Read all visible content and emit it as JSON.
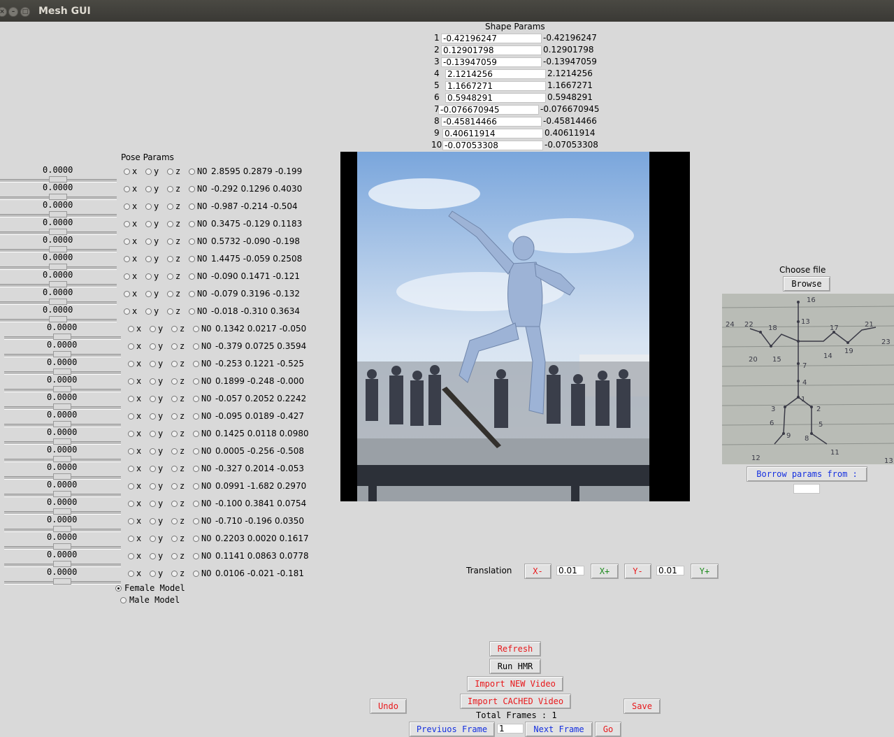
{
  "window": {
    "title": "Mesh GUI"
  },
  "shape": {
    "title": "Shape Params",
    "rows": [
      {
        "idx": "1",
        "value": "-0.42196247",
        "echo": "-0.42196247"
      },
      {
        "idx": "2",
        "value": "0.12901798",
        "echo": "0.12901798"
      },
      {
        "idx": "3",
        "value": "-0.13947059",
        "echo": "-0.13947059"
      },
      {
        "idx": "4",
        "value": "2.1214256",
        "echo": "2.1214256"
      },
      {
        "idx": "5",
        "value": "1.1667271",
        "echo": "1.1667271"
      },
      {
        "idx": "6",
        "value": "0.5948291",
        "echo": "0.5948291"
      },
      {
        "idx": "7",
        "value": "-0.076670945",
        "echo": "-0.076670945"
      },
      {
        "idx": "8",
        "value": "-0.45814466",
        "echo": "-0.45814466"
      },
      {
        "idx": "9",
        "value": "0.40611914",
        "echo": "0.40611914"
      },
      {
        "idx": "10",
        "value": "-0.07053308",
        "echo": "-0.07053308"
      }
    ]
  },
  "pose": {
    "title": "Pose Params",
    "radio_labels": {
      "x": "x",
      "y": "y",
      "z": "z",
      "no": "NO"
    },
    "rows": [
      {
        "slider": "0.0000",
        "vals": "2.8595 0.2879 -0.199"
      },
      {
        "slider": "0.0000",
        "vals": "-0.292 0.1296 0.4030"
      },
      {
        "slider": "0.0000",
        "vals": "-0.987 -0.214 -0.504"
      },
      {
        "slider": "0.0000",
        "vals": "0.3475 -0.129 0.1183"
      },
      {
        "slider": "0.0000",
        "vals": "0.5732 -0.090 -0.198"
      },
      {
        "slider": "0.0000",
        "vals": "1.4475 -0.059 0.2508"
      },
      {
        "slider": "0.0000",
        "vals": "-0.090 0.1471 -0.121"
      },
      {
        "slider": "0.0000",
        "vals": "-0.079 0.3196 -0.132"
      },
      {
        "slider": "0.0000",
        "vals": "-0.018 -0.310 0.3634"
      },
      {
        "slider": "0.0000",
        "vals": "0.1342 0.0217 -0.050"
      },
      {
        "slider": "0.0000",
        "vals": "-0.379 0.0725 0.3594"
      },
      {
        "slider": "0.0000",
        "vals": "-0.253 0.1221 -0.525"
      },
      {
        "slider": "0.0000",
        "vals": "0.1899 -0.248 -0.000"
      },
      {
        "slider": "0.0000",
        "vals": "-0.057 0.2052 0.2242"
      },
      {
        "slider": "0.0000",
        "vals": "-0.095 0.0189 -0.427"
      },
      {
        "slider": "0.0000",
        "vals": "0.1425 0.0118 0.0980"
      },
      {
        "slider": "0.0000",
        "vals": "0.0005 -0.256 -0.508"
      },
      {
        "slider": "0.0000",
        "vals": "-0.327 0.2014 -0.053"
      },
      {
        "slider": "0.0000",
        "vals": "0.0991 -1.682 0.2970"
      },
      {
        "slider": "0.0000",
        "vals": "-0.100 0.3841 0.0754"
      },
      {
        "slider": "0.0000",
        "vals": "-0.710 -0.196 0.0350"
      },
      {
        "slider": "0.0000",
        "vals": "0.2203 0.0020 0.1617"
      },
      {
        "slider": "0.0000",
        "vals": "0.1141 0.0863 0.0778"
      },
      {
        "slider": "0.0000",
        "vals": "0.0106 -0.021 -0.181"
      }
    ]
  },
  "model": {
    "female": "Female Model",
    "male": "Male Model",
    "selected": "female"
  },
  "file": {
    "choose_label": "Choose file",
    "browse": "Browse",
    "borrow": "Borrow params from :",
    "borrow_value": "",
    "joint_labels": [
      "16",
      "13",
      "24",
      "22",
      "18",
      "17",
      "21",
      "23",
      "20",
      "15",
      "14",
      "19",
      "7",
      "4",
      "1",
      "3",
      "2",
      "6",
      "5",
      "9",
      "8",
      "11",
      "12",
      "13"
    ]
  },
  "translation": {
    "label": "Translation",
    "x_minus": "X-",
    "x_step": "0.01",
    "x_plus": "X+",
    "y_minus": "Y-",
    "y_step": "0.01",
    "y_plus": "Y+"
  },
  "actions": {
    "refresh": "Refresh",
    "run_hmr": "Run HMR",
    "import_new": "Import NEW Video",
    "import_cached": "Import CACHED Video",
    "undo": "Undo",
    "save": "Save",
    "total_frames": "Total Frames : 1",
    "prev": "Previuos Frame",
    "frame_value": "1",
    "next": "Next Frame",
    "go": "Go"
  },
  "colors": {
    "red": "#e8181b",
    "green": "#1e8b1e",
    "blue": "#1530e0",
    "bg": "#d9d9d9"
  }
}
